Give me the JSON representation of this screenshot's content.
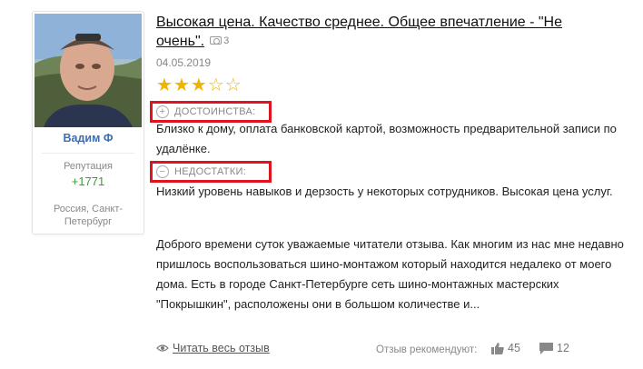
{
  "author": {
    "name": "Вадим Ф",
    "reputation_label": "Репутация",
    "reputation_value": "+1771",
    "location": "Россия, Санкт-Петербург"
  },
  "review": {
    "title": "Высокая цена. Качество среднее. Общее впечатление - \"Не очень\".",
    "photo_count": "3",
    "date": "04.05.2019",
    "rating": 3,
    "rating_max": 5,
    "pros_label": "ДОСТОИНСТВА:",
    "pros_text": "Близко к дому, оплата банковской картой, возможность предварительной записи по удалёнке.",
    "cons_label": "НЕДОСТАТКИ:",
    "cons_text": "Низкий уровень навыков и дерзость у некоторых сотрудников. Высокая цена услуг.",
    "body": "Доброго времени суток уважаемые читатели отзыва. Как многим из нас мне недавно пришлось воспользоваться шино-монтажом который находится недалеко от моего дома. Есть в городе Санкт-Петербурге сеть шино-монтажных мастерских \"Покрышкин\", расположены они в большом количестве и..."
  },
  "footer": {
    "read_all": "Читать весь отзыв",
    "recommend_label": "Отзыв рекомендуют:",
    "likes": "45",
    "comments": "12"
  },
  "colors": {
    "link": "#3a6fb0",
    "reputation": "#3b9a3b",
    "star": "#f0b400",
    "highlight": "#e0141f"
  },
  "icons": [
    "camera-icon",
    "star-icon",
    "plus-circle-icon",
    "minus-circle-icon",
    "eye-icon",
    "thumbs-up-icon",
    "comment-icon"
  ]
}
